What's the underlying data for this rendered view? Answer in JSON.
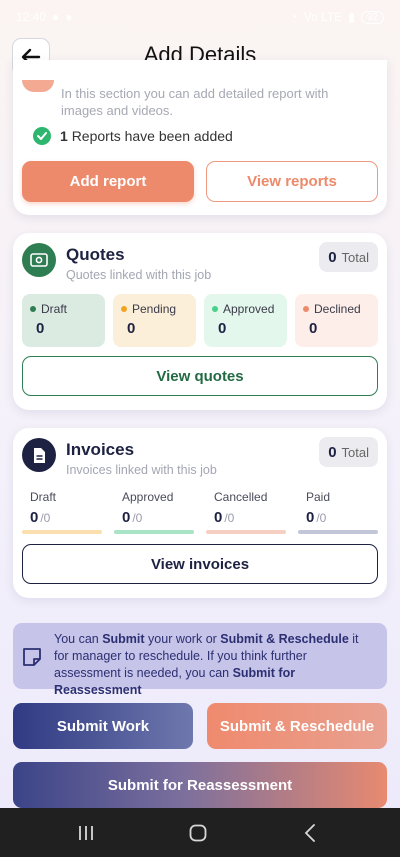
{
  "status_bar": {
    "time": "12:40",
    "network": "Vo LTE",
    "battery": "92"
  },
  "header": {
    "title": "Add Details"
  },
  "reports": {
    "description": "In this section you can add detailed report with images and videos.",
    "count": "1",
    "count_text": "Reports have been added",
    "add_label": "Add report",
    "view_label": "View reports"
  },
  "quotes": {
    "title": "Quotes",
    "subtitle": "Quotes linked with this job",
    "total_value": "0",
    "total_label": "Total",
    "tiles": [
      {
        "label": "Draft",
        "value": "0",
        "bg": "#dcebe2",
        "dot": "#2f7d52"
      },
      {
        "label": "Pending",
        "value": "0",
        "bg": "#fcefd9",
        "dot": "#f0a41f"
      },
      {
        "label": "Approved",
        "value": "0",
        "bg": "#e3f7ec",
        "dot": "#49d08a"
      },
      {
        "label": "Declined",
        "value": "0",
        "bg": "#fdeee9",
        "dot": "#ee8a6c"
      }
    ],
    "view_label": "View quotes"
  },
  "invoices": {
    "title": "Invoices",
    "subtitle": "Invoices linked with this job",
    "total_value": "0",
    "total_label": "Total",
    "columns": [
      {
        "label": "Draft",
        "value": "0",
        "of": "/0",
        "bar": "#fbdfae"
      },
      {
        "label": "Approved",
        "value": "0",
        "of": "/0",
        "bar": "#a9e4c6"
      },
      {
        "label": "Cancelled",
        "value": "0",
        "of": "/0",
        "bar": "#f6cfc3"
      },
      {
        "label": "Paid",
        "value": "0",
        "of": "/0",
        "bar": "#c3c6d9"
      }
    ],
    "view_label": "View invoices"
  },
  "info": {
    "t1": "You can ",
    "b1": "Submit",
    "t2": " your work or ",
    "b2": "Submit & Reschedule",
    "t3": " it for manager to reschedule. If you think further assessment is needed, you can ",
    "b3": "Submit for Reassessment"
  },
  "actions": {
    "submit_work": "Submit Work",
    "submit_reschedule": "Submit & Reschedule",
    "submit_reassessment": "Submit for Reassessment"
  },
  "colors": {
    "brand_navy": "#1d2242",
    "accent_orange": "#ee8a6c",
    "quotes_green": "#2f7d52"
  }
}
